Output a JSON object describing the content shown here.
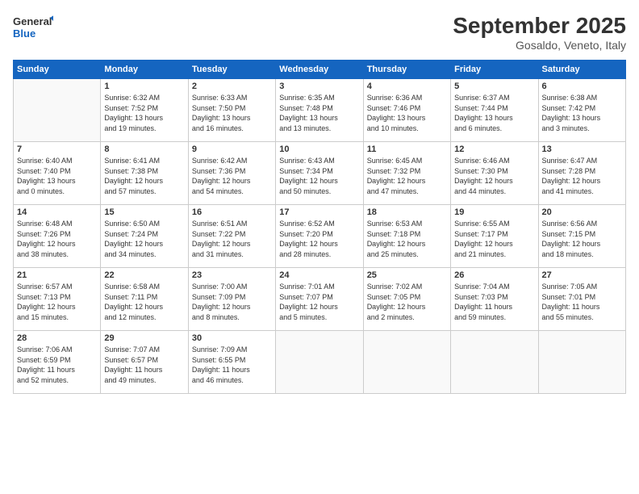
{
  "logo": {
    "line1": "General",
    "line2": "Blue"
  },
  "title": "September 2025",
  "subtitle": "Gosaldo, Veneto, Italy",
  "weekdays": [
    "Sunday",
    "Monday",
    "Tuesday",
    "Wednesday",
    "Thursday",
    "Friday",
    "Saturday"
  ],
  "weeks": [
    [
      {
        "day": "",
        "info": ""
      },
      {
        "day": "1",
        "info": "Sunrise: 6:32 AM\nSunset: 7:52 PM\nDaylight: 13 hours\nand 19 minutes."
      },
      {
        "day": "2",
        "info": "Sunrise: 6:33 AM\nSunset: 7:50 PM\nDaylight: 13 hours\nand 16 minutes."
      },
      {
        "day": "3",
        "info": "Sunrise: 6:35 AM\nSunset: 7:48 PM\nDaylight: 13 hours\nand 13 minutes."
      },
      {
        "day": "4",
        "info": "Sunrise: 6:36 AM\nSunset: 7:46 PM\nDaylight: 13 hours\nand 10 minutes."
      },
      {
        "day": "5",
        "info": "Sunrise: 6:37 AM\nSunset: 7:44 PM\nDaylight: 13 hours\nand 6 minutes."
      },
      {
        "day": "6",
        "info": "Sunrise: 6:38 AM\nSunset: 7:42 PM\nDaylight: 13 hours\nand 3 minutes."
      }
    ],
    [
      {
        "day": "7",
        "info": "Sunrise: 6:40 AM\nSunset: 7:40 PM\nDaylight: 13 hours\nand 0 minutes."
      },
      {
        "day": "8",
        "info": "Sunrise: 6:41 AM\nSunset: 7:38 PM\nDaylight: 12 hours\nand 57 minutes."
      },
      {
        "day": "9",
        "info": "Sunrise: 6:42 AM\nSunset: 7:36 PM\nDaylight: 12 hours\nand 54 minutes."
      },
      {
        "day": "10",
        "info": "Sunrise: 6:43 AM\nSunset: 7:34 PM\nDaylight: 12 hours\nand 50 minutes."
      },
      {
        "day": "11",
        "info": "Sunrise: 6:45 AM\nSunset: 7:32 PM\nDaylight: 12 hours\nand 47 minutes."
      },
      {
        "day": "12",
        "info": "Sunrise: 6:46 AM\nSunset: 7:30 PM\nDaylight: 12 hours\nand 44 minutes."
      },
      {
        "day": "13",
        "info": "Sunrise: 6:47 AM\nSunset: 7:28 PM\nDaylight: 12 hours\nand 41 minutes."
      }
    ],
    [
      {
        "day": "14",
        "info": "Sunrise: 6:48 AM\nSunset: 7:26 PM\nDaylight: 12 hours\nand 38 minutes."
      },
      {
        "day": "15",
        "info": "Sunrise: 6:50 AM\nSunset: 7:24 PM\nDaylight: 12 hours\nand 34 minutes."
      },
      {
        "day": "16",
        "info": "Sunrise: 6:51 AM\nSunset: 7:22 PM\nDaylight: 12 hours\nand 31 minutes."
      },
      {
        "day": "17",
        "info": "Sunrise: 6:52 AM\nSunset: 7:20 PM\nDaylight: 12 hours\nand 28 minutes."
      },
      {
        "day": "18",
        "info": "Sunrise: 6:53 AM\nSunset: 7:18 PM\nDaylight: 12 hours\nand 25 minutes."
      },
      {
        "day": "19",
        "info": "Sunrise: 6:55 AM\nSunset: 7:17 PM\nDaylight: 12 hours\nand 21 minutes."
      },
      {
        "day": "20",
        "info": "Sunrise: 6:56 AM\nSunset: 7:15 PM\nDaylight: 12 hours\nand 18 minutes."
      }
    ],
    [
      {
        "day": "21",
        "info": "Sunrise: 6:57 AM\nSunset: 7:13 PM\nDaylight: 12 hours\nand 15 minutes."
      },
      {
        "day": "22",
        "info": "Sunrise: 6:58 AM\nSunset: 7:11 PM\nDaylight: 12 hours\nand 12 minutes."
      },
      {
        "day": "23",
        "info": "Sunrise: 7:00 AM\nSunset: 7:09 PM\nDaylight: 12 hours\nand 8 minutes."
      },
      {
        "day": "24",
        "info": "Sunrise: 7:01 AM\nSunset: 7:07 PM\nDaylight: 12 hours\nand 5 minutes."
      },
      {
        "day": "25",
        "info": "Sunrise: 7:02 AM\nSunset: 7:05 PM\nDaylight: 12 hours\nand 2 minutes."
      },
      {
        "day": "26",
        "info": "Sunrise: 7:04 AM\nSunset: 7:03 PM\nDaylight: 11 hours\nand 59 minutes."
      },
      {
        "day": "27",
        "info": "Sunrise: 7:05 AM\nSunset: 7:01 PM\nDaylight: 11 hours\nand 55 minutes."
      }
    ],
    [
      {
        "day": "28",
        "info": "Sunrise: 7:06 AM\nSunset: 6:59 PM\nDaylight: 11 hours\nand 52 minutes."
      },
      {
        "day": "29",
        "info": "Sunrise: 7:07 AM\nSunset: 6:57 PM\nDaylight: 11 hours\nand 49 minutes."
      },
      {
        "day": "30",
        "info": "Sunrise: 7:09 AM\nSunset: 6:55 PM\nDaylight: 11 hours\nand 46 minutes."
      },
      {
        "day": "",
        "info": ""
      },
      {
        "day": "",
        "info": ""
      },
      {
        "day": "",
        "info": ""
      },
      {
        "day": "",
        "info": ""
      }
    ]
  ]
}
